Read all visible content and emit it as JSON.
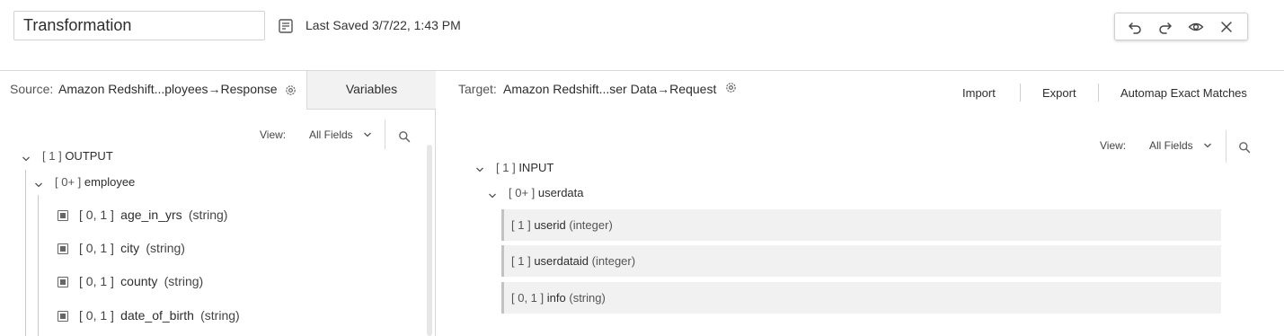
{
  "header": {
    "title_value": "Transformation",
    "saved_text": "Last Saved 3/7/22, 1:43 PM",
    "toolbar": {
      "undo": "undo-icon",
      "redo": "redo-icon",
      "preview": "eye-icon",
      "close": "close-icon"
    }
  },
  "source": {
    "label": "Source:",
    "value": "Amazon Redshift...ployees→Response",
    "variables_tab": "Variables",
    "view_label": "View:",
    "view_value": "All Fields",
    "tree": {
      "root": {
        "bracket": "[ 1 ]",
        "name": "OUTPUT"
      },
      "child": {
        "bracket": "[ 0+ ]",
        "name": "employee"
      },
      "fields": [
        {
          "bracket": "[ 0, 1 ]",
          "name": "age_in_yrs",
          "type": "(string)"
        },
        {
          "bracket": "[ 0, 1 ]",
          "name": "city",
          "type": "(string)"
        },
        {
          "bracket": "[ 0, 1 ]",
          "name": "county",
          "type": "(string)"
        },
        {
          "bracket": "[ 0, 1 ]",
          "name": "date_of_birth",
          "type": "(string)"
        }
      ]
    }
  },
  "target": {
    "label": "Target:",
    "value": "Amazon Redshift...ser Data→Request",
    "actions": {
      "import": "Import",
      "export": "Export",
      "automap": "Automap Exact Matches"
    },
    "view_label": "View:",
    "view_value": "All Fields",
    "tree": {
      "root": {
        "bracket": "[ 1 ]",
        "name": "INPUT"
      },
      "child": {
        "bracket": "[ 0+ ]",
        "name": "userdata"
      },
      "fields": [
        {
          "bracket": "[ 1 ]",
          "name": "userid",
          "type": "(integer)"
        },
        {
          "bracket": "[ 1 ]",
          "name": "userdataid",
          "type": "(integer)"
        },
        {
          "bracket": "[ 0, 1 ]",
          "name": "info",
          "type": "(string)"
        }
      ]
    }
  }
}
